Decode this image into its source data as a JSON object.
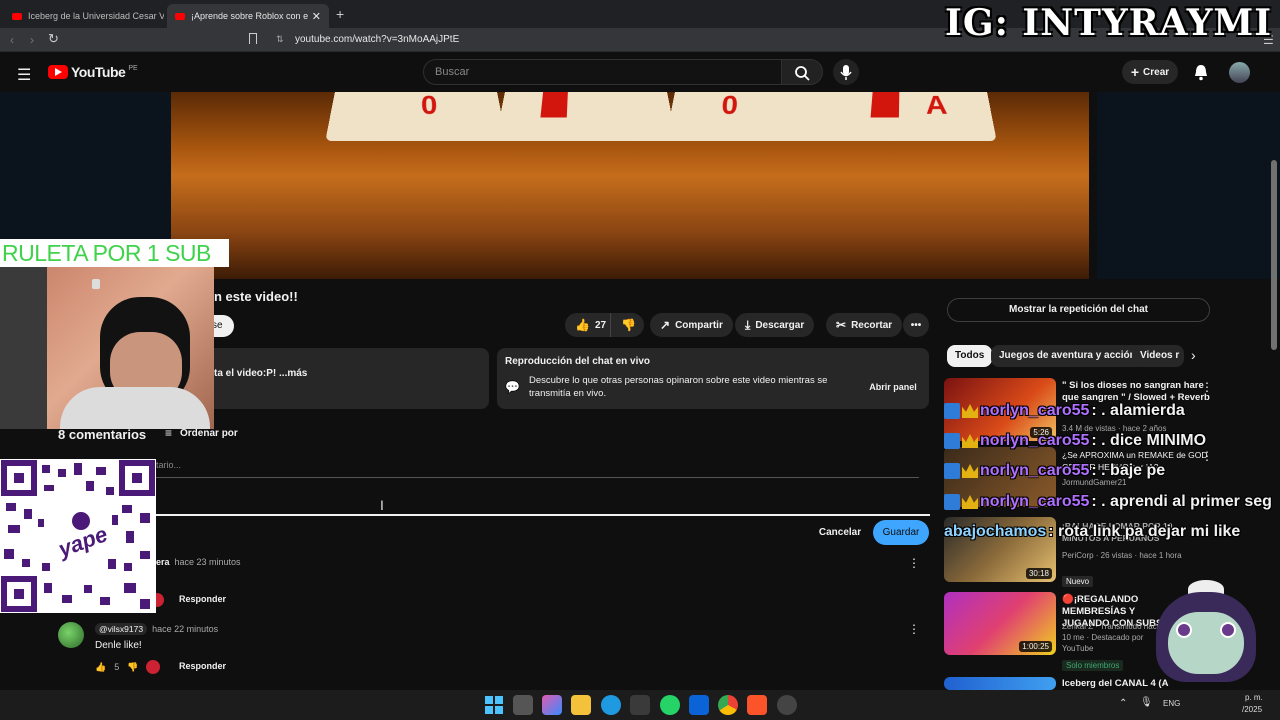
{
  "browser": {
    "tabs": [
      {
        "title": "Iceberg de la Universidad Cesar Valle",
        "active": false
      },
      {
        "title": "¡Aprende sobre Roblox con este",
        "active": true
      }
    ],
    "new_tab": "+",
    "url": "youtube.com/watch?v=3nMoAAjJPtE"
  },
  "overlay": {
    "ig_handle": "IG: INTYRAYMI",
    "ruleta": "RULETA POR 1 SUB",
    "qr_brand": "yape"
  },
  "youtube": {
    "logo": "YouTube",
    "logo_region": "PE",
    "search_placeholder": "Buscar",
    "create_label": "Crear",
    "video_title_visible": "n este video!!",
    "subscribe_partial": "se",
    "like_count": "27",
    "share_label": "Compartir",
    "download_label": "Descargar",
    "clip_label": "Recortar",
    "description_snippet": "ta el video:P! ...más",
    "live_chat": {
      "title": "Reproducción del chat en vivo",
      "body": "Descubre lo que otras personas opinaron sobre este video mientras se transmitía en vivo.",
      "open_panel": "Abrir panel"
    },
    "comments": {
      "count_label": "8 comentarios",
      "sort_label": "Ordenar por",
      "add_placeholder": "tario...",
      "cancel_label": "Cancelar",
      "save_label": "Guardar",
      "items": [
        {
          "author": "era",
          "time": "hace 23 minutos",
          "text": "",
          "likes": "",
          "reply": "Responder"
        },
        {
          "author": "@vilsx9173",
          "time": "hace 22 minutos",
          "text": "Denle like!",
          "likes": "5",
          "reply": "Responder"
        }
      ]
    },
    "sidebar": {
      "chat_replay_button": "Mostrar la repetición del chat",
      "chips": [
        "Todos",
        "Juegos de aventura y acción",
        "Videos r"
      ],
      "videos": [
        {
          "title": "\" Si los dioses no sangran hare que sangren \" / Slowed + Reverb",
          "meta": "3.4 M de vistas · hace 2 años",
          "duration": "5:26"
        },
        {
          "title": "¿Se APROXIMA un REMAKE de GOD OF WAR HECHO por IA?",
          "meta": "JormundGamer21",
          "duration": ""
        },
        {
          "title": "¡BALHACE LOMAR POR 10 MINUTOS A PERUANOS",
          "meta": "PeriCorp · 26 vistas · hace 1 hora",
          "badge": "Nuevo",
          "duration": "30:18"
        },
        {
          "title": "🔴¡REGALANDO MEMBRESÍAS Y JUGANDO CON SUBS",
          "meta": "Zenkai Z · Transmitido hace 10 me · Destacado por YouTube",
          "badge": "Solo miembros",
          "duration": "1:00:25"
        },
        {
          "title": "Iceberg del CANAL 4 (A",
          "meta": "",
          "duration": ""
        }
      ]
    }
  },
  "stream_chat": [
    {
      "user": "norlyn_caro55",
      "message": ": . alamierda"
    },
    {
      "user": "norlyn_caro55",
      "message": ": . dice MINIMO"
    },
    {
      "user": "norlyn_caro55",
      "message": ": . baje pe"
    },
    {
      "user": "norlyn_caro55",
      "message": ": . aprendi al primer seg"
    },
    {
      "user": "abajochamos",
      "message": ": rota link pa dejar mi like"
    }
  ],
  "taskbar": {
    "lang": "ENG",
    "time": "p. m.",
    "date": "/2025"
  }
}
